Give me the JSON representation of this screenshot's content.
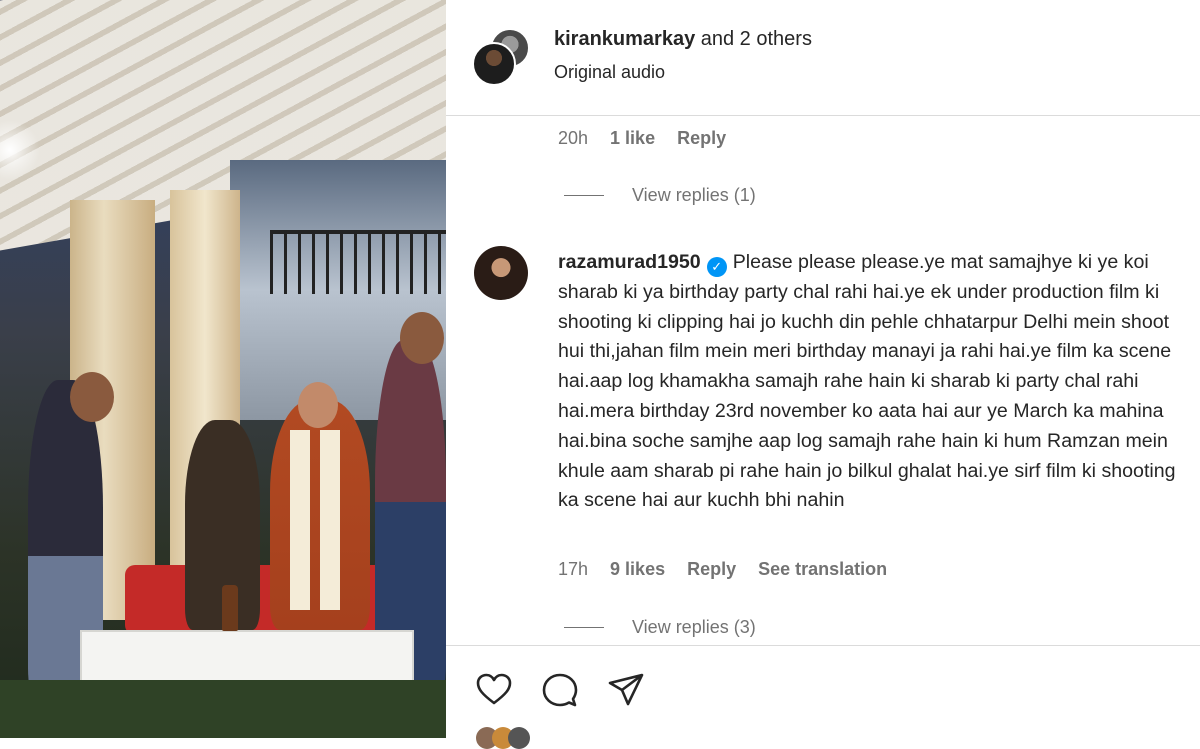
{
  "header": {
    "username": "kirankumarkay",
    "others_text": " and 2 others",
    "subtitle": "Original audio"
  },
  "prev_comment": {
    "time": "20h",
    "likes": "1 like",
    "reply_label": "Reply",
    "view_replies": "View replies (1)"
  },
  "comment": {
    "username": "razamurad1950",
    "verified_icon": "verified-badge-icon",
    "text": "Please please please.ye mat samajhye ki ye koi sharab ki ya birthday party chal rahi hai.ye ek under production film ki shooting ki clipping hai jo kuchh din pehle chhatarpur Delhi mein shoot hui thi,jahan film mein meri birthday manayi ja rahi hai.ye film ka scene hai.aap log khamakha samajh rahe hain ki sharab ki party chal rahi hai.mera birthday 23rd november ko aata hai aur ye March ka mahina hai.bina soche samjhe aap log samajh rahe hain ki hum Ramzan mein khule aam sharab pi rahe hain jo bilkul ghalat hai.ye sirf film ki shooting ka scene hai aur kuchh bhi nahin",
    "time": "17h",
    "likes": "9 likes",
    "reply_label": "Reply",
    "translate_label": "See translation",
    "view_replies": "View replies (3)"
  },
  "actions": {
    "like_icon": "heart-icon",
    "comment_icon": "comment-icon",
    "share_icon": "paper-plane-icon"
  },
  "colors": {
    "text_primary": "#262626",
    "text_secondary": "#737373",
    "verified": "#0095f6",
    "divider": "#dbdbdb"
  }
}
